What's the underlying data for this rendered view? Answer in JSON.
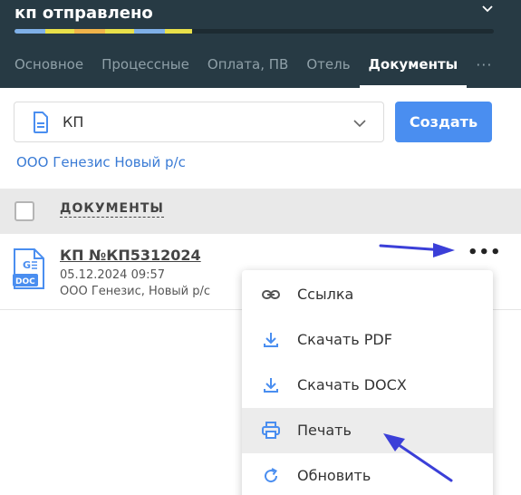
{
  "header": {
    "status_title": "кп отправлено",
    "progress_colors": [
      "#7fb0e8",
      "#e8e04a",
      "#f0b34a",
      "#e8e04a",
      "#7fb0e8",
      "#e8e04a"
    ],
    "tabs": [
      {
        "label": "Основное",
        "active": false
      },
      {
        "label": "Процессные",
        "active": false
      },
      {
        "label": "Оплата, ПВ",
        "active": false
      },
      {
        "label": "Отель",
        "active": false
      },
      {
        "label": "Документы",
        "active": true
      }
    ],
    "more_label": "···"
  },
  "template_select": {
    "value": "КП",
    "create_label": "Создать"
  },
  "company_link": "ООО Генезис Новый р/с",
  "documents": {
    "column_title": "ДОКУМЕНТЫ",
    "items": [
      {
        "name": "КП №КП5312024",
        "date": "05.12.2024 09:57",
        "company": "ООО Генезис, Новый р/с",
        "file_badge": "DOC",
        "more_label": "•••"
      }
    ]
  },
  "menu": {
    "items": [
      {
        "label": "Ссылка",
        "icon": "link-icon"
      },
      {
        "label": "Скачать PDF",
        "icon": "download-icon"
      },
      {
        "label": "Скачать DOCX",
        "icon": "download-icon"
      },
      {
        "label": "Печать",
        "icon": "printer-icon"
      },
      {
        "label": "Обновить",
        "icon": "refresh-icon"
      }
    ],
    "highlighted": "Печать"
  },
  "colors": {
    "header_bg": "#273a44",
    "accent_blue": "#4a8ef0",
    "link_blue": "#3a7bd5",
    "annotation_arrow": "#3b3fd8"
  }
}
